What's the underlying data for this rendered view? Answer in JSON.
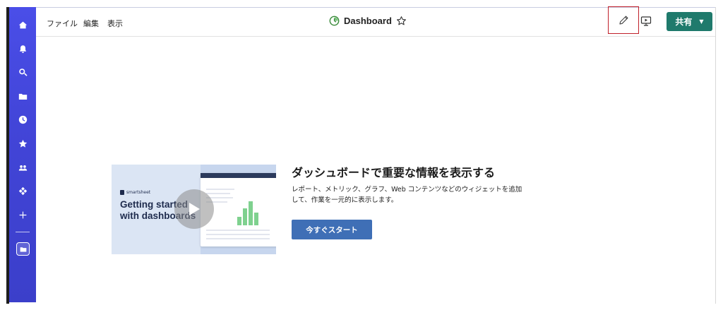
{
  "menu": {
    "file": "ファイル",
    "edit": "編集",
    "view": "表示"
  },
  "header": {
    "title": "Dashboard",
    "share_label": "共有"
  },
  "sidebar": {
    "icons": [
      "home-icon",
      "bell-icon",
      "search-icon",
      "folder-icon",
      "clock-icon",
      "star-icon",
      "people-icon",
      "apps-icon",
      "plus-icon",
      "workspace-icon"
    ]
  },
  "hero": {
    "video_logo": "smartsheet",
    "video_title": "Getting started\nwith dashboards",
    "headline": "ダッシュボードで重要な情報を表示する",
    "description": "レポート、メトリック、グラフ、Web コンテンツなどのウィジェットを追加して、作業を一元的に表示します。",
    "cta_label": "今すぐスタート"
  },
  "colors": {
    "sidebar": "#4245d8",
    "share_button": "#1f7a6c",
    "cta_button": "#3f6fb6",
    "highlight": "#c0202a"
  }
}
